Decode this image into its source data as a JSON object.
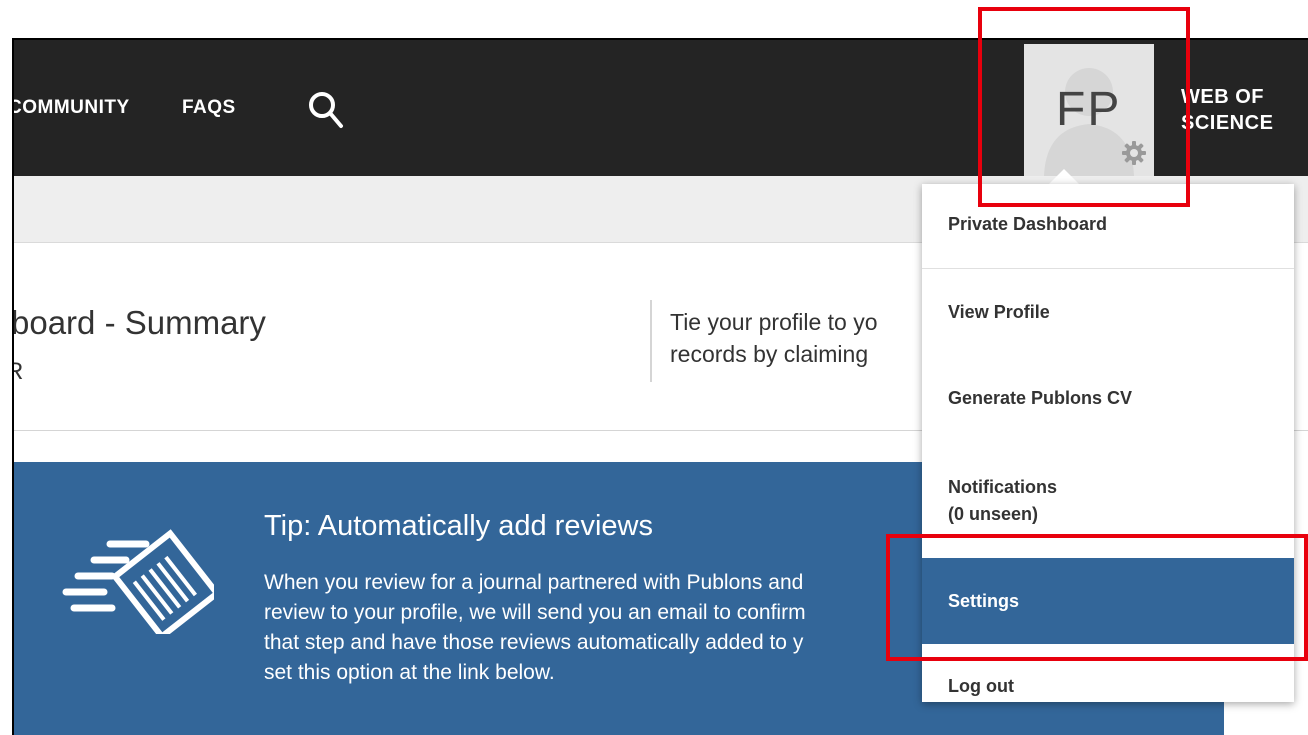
{
  "nav": {
    "community": "COMMUNITY",
    "faqs": "FAQS",
    "avatar_initials": "FP",
    "wos_line1": "WEB OF",
    "wos_line2": "SCIENCE"
  },
  "dashboard": {
    "title": "board - Summary",
    "subtitle": "R",
    "tie_line1": "Tie your profile to yo",
    "tie_line2": "records by claiming"
  },
  "tip": {
    "title": "Tip:  Automatically add reviews",
    "body_lines": [
      "When you review for a journal partnered with Publons and",
      "review to your profile, we will send you an email to confirm",
      "that step and have those reviews automatically added to y",
      "set this option at the link below."
    ]
  },
  "menu": {
    "items": [
      {
        "label": "Private Dashboard"
      },
      {
        "label": "View Profile"
      },
      {
        "label": "Generate Publons CV"
      },
      {
        "label": "Notifications"
      },
      {
        "label": "Settings"
      },
      {
        "label": "Log out"
      }
    ],
    "notifications_sub": "(0 unseen)"
  },
  "colors": {
    "nav_bg": "#242424",
    "accent_blue": "#336699",
    "annotation_red": "#e8000d"
  },
  "icons": [
    "search-icon",
    "gear-icon",
    "review-document-icon"
  ]
}
